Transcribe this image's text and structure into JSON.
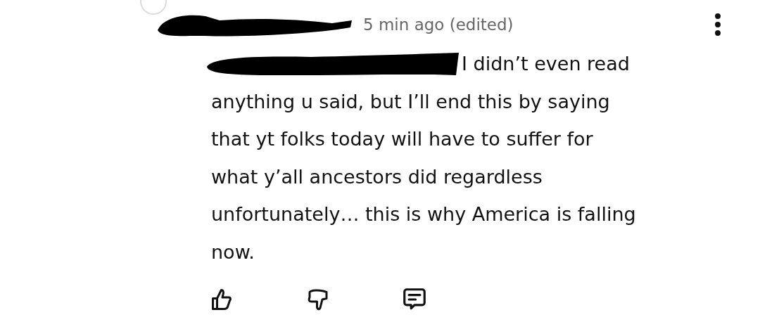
{
  "comment": {
    "timestamp": "5 min ago (edited)",
    "lines": [
      "I didn’t even read",
      "anything u said, but I’ll end this by saying",
      "that yt folks today will have to suffer for",
      "what y’all ancestors did regardless",
      "unfortunately… this is why America is falling",
      "now."
    ]
  }
}
